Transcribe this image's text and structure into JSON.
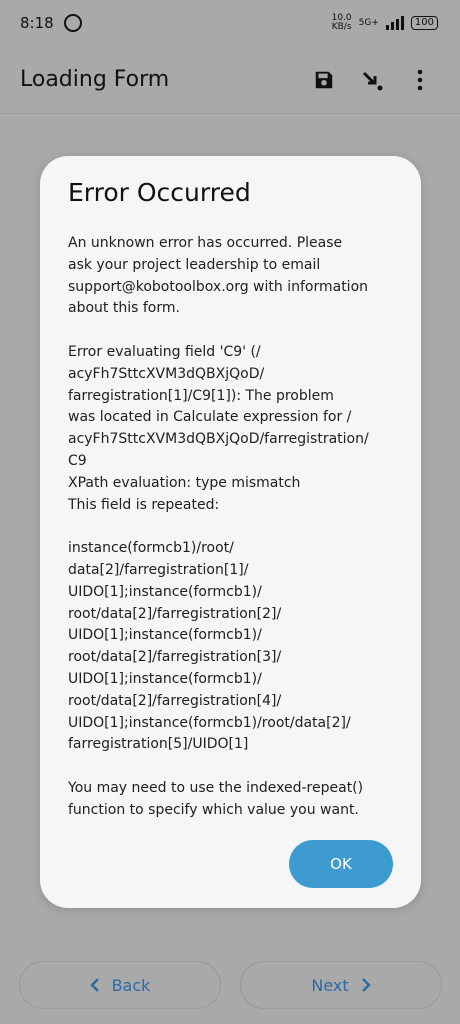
{
  "status_bar": {
    "time": "8:18",
    "net_speed_top": "10.0",
    "net_speed_bottom": "KB/s",
    "network": "5G+",
    "battery": "100"
  },
  "toolbar": {
    "title": "Loading Form",
    "icons": [
      "save-icon",
      "download-arrow-icon",
      "more-vert-icon"
    ]
  },
  "dialog": {
    "title": "Error Occurred",
    "message": "An unknown error has occurred. Please\nask your project leadership to email\nsupport@kobotoolbox.org with information\nabout this form.\n\nError evaluating field 'C9' (/\nacyFh7SttcXVM3dQBXjQoD/\nfarregistration[1]/C9[1]): The problem\nwas located in Calculate expression for /\nacyFh7SttcXVM3dQBXjQoD/farregistration/\nC9\nXPath evaluation: type mismatch\nThis field is repeated:\n\ninstance(formcb1)/root/\ndata[2]/farregistration[1]/\nUIDO[1];instance(formcb1)/\nroot/data[2]/farregistration[2]/\nUIDO[1];instance(formcb1)/\nroot/data[2]/farregistration[3]/\nUIDO[1];instance(formcb1)/\nroot/data[2]/farregistration[4]/\nUIDO[1];instance(formcb1)/root/data[2]/\nfarregistration[5]/UIDO[1]\n\nYou may need to use the indexed-repeat()\nfunction to specify which value you want.",
    "ok_label": "OK"
  },
  "nav": {
    "back_label": "Back",
    "next_label": "Next"
  },
  "colors": {
    "accent": "#3d9bcf",
    "nav_text": "#2a6aa8",
    "overlay": "#a9a9a9"
  }
}
